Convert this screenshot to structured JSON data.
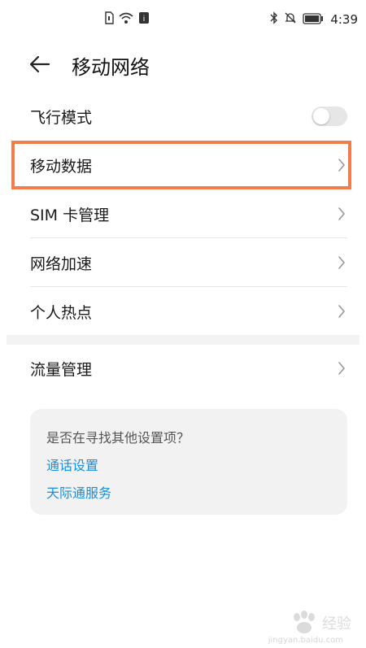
{
  "status_bar": {
    "time": "4:39",
    "icons": [
      "sim-icon",
      "wifi-icon",
      "hd-icon",
      "bluetooth-icon",
      "mute-icon",
      "battery-icon"
    ],
    "nfc_glyph": "i"
  },
  "header": {
    "title": "移动网络"
  },
  "settings": {
    "items": [
      {
        "label": "飞行模式",
        "control": "toggle",
        "on": false
      },
      {
        "label": "移动数据",
        "control": "chevron"
      },
      {
        "label": "SIM 卡管理",
        "control": "chevron"
      },
      {
        "label": "网络加速",
        "control": "chevron"
      },
      {
        "label": "个人热点",
        "control": "chevron"
      },
      {
        "label": "流量管理",
        "control": "chevron"
      }
    ]
  },
  "suggestions": {
    "title": "是否在寻找其他设置项？",
    "links": [
      "通话设置",
      "天际通服务"
    ]
  },
  "colors": {
    "highlight": "#f07d4a",
    "link": "#1a8fd6",
    "toggle_off": "#e6e6e6"
  },
  "watermark": {
    "text": "经验",
    "url": "jingyan.baidu.com"
  }
}
